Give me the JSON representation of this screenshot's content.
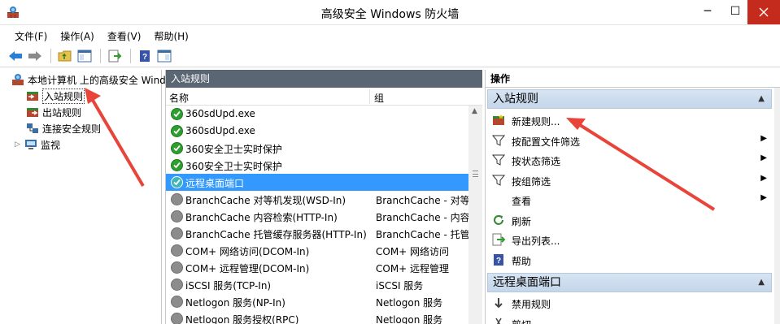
{
  "window": {
    "title": "高级安全 Windows 防火墙",
    "min_label": "─",
    "max_label": "☐"
  },
  "menu": [
    "文件(F)",
    "操作(A)",
    "查看(V)",
    "帮助(H)"
  ],
  "tree": {
    "root": "本地计算机 上的高级安全 Wind",
    "items": [
      "入站规则",
      "出站规则",
      "连接安全规则",
      "监视"
    ],
    "expand_glyph": "▷"
  },
  "center": {
    "header": "入站规则",
    "col_name": "名称",
    "col_group": "组",
    "rules": [
      {
        "name": "360sdUpd.exe",
        "group": "",
        "status": "on"
      },
      {
        "name": "360sdUpd.exe",
        "group": "",
        "status": "on"
      },
      {
        "name": "360安全卫士实时保护",
        "group": "",
        "status": "on"
      },
      {
        "name": "360安全卫士实时保护",
        "group": "",
        "status": "on"
      },
      {
        "name": "远程桌面端口",
        "group": "",
        "status": "sel"
      },
      {
        "name": "BranchCache 对等机发现(WSD-In)",
        "group": "BranchCache - 对等",
        "status": "off"
      },
      {
        "name": "BranchCache 内容检索(HTTP-In)",
        "group": "BranchCache - 内容",
        "status": "off"
      },
      {
        "name": "BranchCache 托管缓存服务器(HTTP-In)",
        "group": "BranchCache - 托管",
        "status": "off"
      },
      {
        "name": "COM+ 网络访问(DCOM-In)",
        "group": "COM+ 网络访问",
        "status": "off"
      },
      {
        "name": "COM+ 远程管理(DCOM-In)",
        "group": "COM+ 远程管理",
        "status": "off"
      },
      {
        "name": "iSCSI 服务(TCP-In)",
        "group": "iSCSI 服务",
        "status": "off"
      },
      {
        "name": "Netlogon 服务(NP-In)",
        "group": "Netlogon 服务",
        "status": "off"
      },
      {
        "name": "Netlogon 服务授权(RPC)",
        "group": "Netlogon 服务",
        "status": "off"
      }
    ]
  },
  "actions": {
    "header": "操作",
    "section1": "入站规则",
    "section1_items": [
      {
        "label": "新建规则...",
        "icon": "new-rule-icon",
        "sub": false
      },
      {
        "label": "按配置文件筛选",
        "icon": "filter-icon",
        "sub": true
      },
      {
        "label": "按状态筛选",
        "icon": "filter-icon",
        "sub": true
      },
      {
        "label": "按组筛选",
        "icon": "filter-icon",
        "sub": true
      },
      {
        "label": "查看",
        "icon": "",
        "sub": true
      },
      {
        "label": "刷新",
        "icon": "refresh-icon",
        "sub": false
      },
      {
        "label": "导出列表...",
        "icon": "export-icon",
        "sub": false
      },
      {
        "label": "帮助",
        "icon": "help-icon",
        "sub": false
      }
    ],
    "section2": "远程桌面端口",
    "section2_items": [
      {
        "label": "禁用规则",
        "icon": "disable-icon",
        "sub": false
      },
      {
        "label": "剪切",
        "icon": "cut-icon",
        "sub": false
      }
    ],
    "caret": "▲",
    "submenu_arrow": "▶"
  },
  "colors": {
    "panel_header": "#5a6673",
    "selection": "#3399ff",
    "enabled": "#2e9e2e",
    "disabled": "#8c8c8c",
    "annotation_arrow": "#e8443a"
  }
}
